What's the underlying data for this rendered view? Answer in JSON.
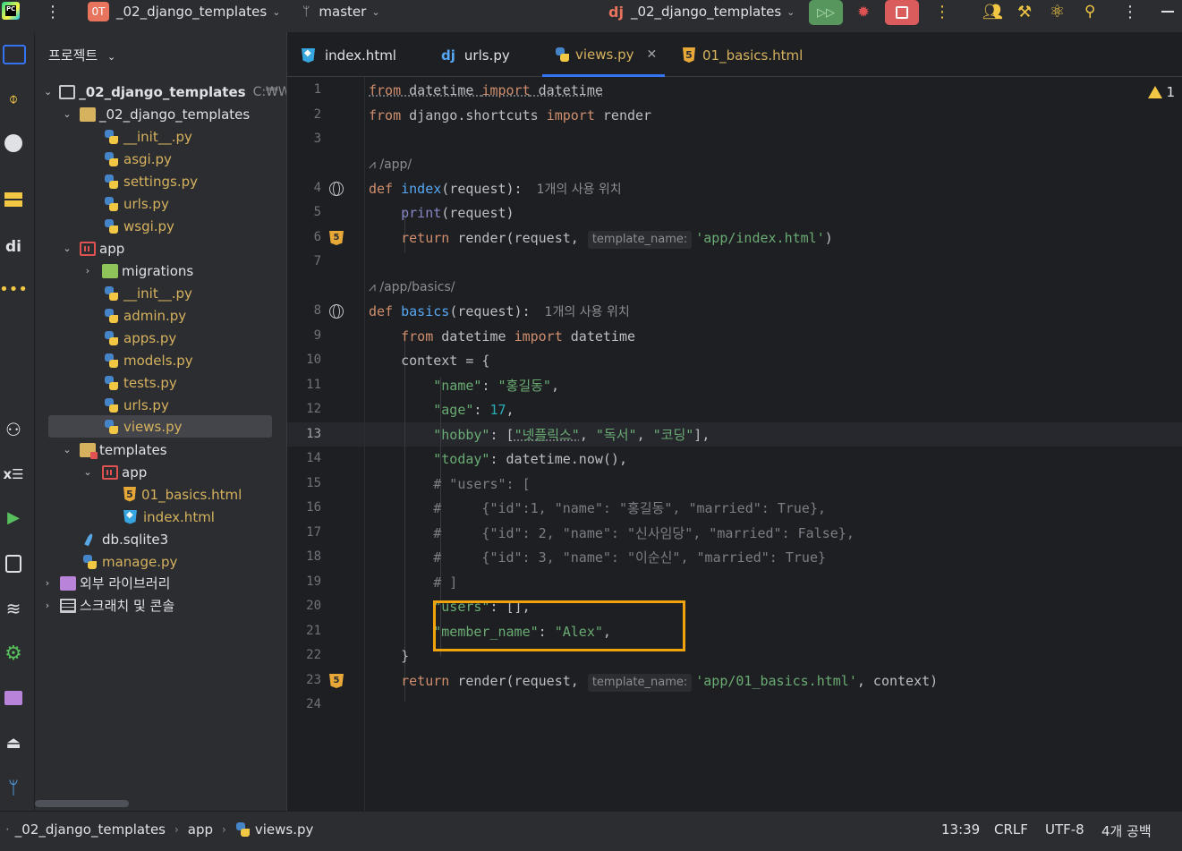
{
  "topbar": {
    "project_badge": "0T",
    "project_name": "_02_django_templates",
    "branch": "master",
    "run_config": "_02_django_templates"
  },
  "project_panel": {
    "title": "프로젝트",
    "root_name": "_02_django_templates",
    "root_path": "C:₩Wo",
    "items": [
      {
        "label": "_02_django_templates"
      },
      {
        "label": "__init__.py"
      },
      {
        "label": "asgi.py"
      },
      {
        "label": "settings.py"
      },
      {
        "label": "urls.py"
      },
      {
        "label": "wsgi.py"
      },
      {
        "label": "app"
      },
      {
        "label": "migrations"
      },
      {
        "label": "__init__.py"
      },
      {
        "label": "admin.py"
      },
      {
        "label": "apps.py"
      },
      {
        "label": "models.py"
      },
      {
        "label": "tests.py"
      },
      {
        "label": "urls.py"
      },
      {
        "label": "views.py"
      },
      {
        "label": "templates"
      },
      {
        "label": "app"
      },
      {
        "label": "01_basics.html"
      },
      {
        "label": "index.html"
      },
      {
        "label": "db.sqlite3"
      },
      {
        "label": "manage.py"
      },
      {
        "label": "외부 라이브러리"
      },
      {
        "label": "스크래치 및 콘솔"
      }
    ]
  },
  "tabs": [
    {
      "label": "index.html"
    },
    {
      "label": "urls.py"
    },
    {
      "label": "views.py"
    },
    {
      "label": "01_basics.html"
    }
  ],
  "editor": {
    "warning_count": "1",
    "line_numbers": [
      "1",
      "2",
      "3",
      "4",
      "5",
      "6",
      "7",
      "8",
      "9",
      "10",
      "11",
      "12",
      "13",
      "14",
      "15",
      "16",
      "17",
      "18",
      "19",
      "20",
      "21",
      "22",
      "23",
      "24"
    ],
    "route1": "/app/",
    "route2": "/app/basics/",
    "usage_hint1": "1개의 사용 위치",
    "usage_hint2": "1개의 사용 위치",
    "inlay_template_name": "template_name:",
    "code": {
      "l1_a": "from",
      "l1_b": " datetime ",
      "l1_c": "import",
      "l1_d": " datetime",
      "l2_a": "from",
      "l2_b": " django.shortcuts ",
      "l2_c": "import",
      "l2_d": " render",
      "l4_def": "def",
      "l4_fn": "index",
      "l4_rest": "(request):",
      "l5_fn": "print",
      "l5_rest": "(request)",
      "l6_kw": "return",
      "l6_a": " render(request,",
      "l6_str": "'app/index.html'",
      "l6_end": ")",
      "l8_def": "def",
      "l8_fn": "basics",
      "l8_rest": "(request):",
      "l9_a": "from",
      "l9_b": " datetime ",
      "l9_c": "import",
      "l9_d": " datetime",
      "l10": "context = {",
      "l11_k": "\"name\"",
      "l11_s": "\"홍길동\"",
      "l12_k": "\"age\"",
      "l12_n": "17",
      "l13_k": "\"hobby\"",
      "l13_s1": "\"넷플릭스\"",
      "l13_s2": "\"독서\"",
      "l13_s3": "\"코딩\"",
      "l14_k": "\"today\"",
      "l14_rest": "datetime.now(),",
      "l15": "# \"users\": [",
      "l16": "#     {\"id\":1, \"name\": \"홍길동\", \"married\": True},",
      "l17": "#     {\"id\": 2, \"name\": \"신사임당\", \"married\": False},",
      "l18": "#     {\"id\": 3, \"name\": \"이순신\", \"married\": True}",
      "l19": "# ]",
      "l20_k": "\"users\"",
      "l20_rest": "[],",
      "l21_k": "\"member_name\"",
      "l21_s": "\"Alex\"",
      "l22": "}",
      "l23_kw": "return",
      "l23_a": " render(request,",
      "l23_str": "'app/01_basics.html'",
      "l23_end": ", context)"
    }
  },
  "statusbar": {
    "crumb1": "_02_django_templates",
    "crumb2": "app",
    "crumb3": "views.py",
    "position": "13:39",
    "line_sep": "CRLF",
    "encoding": "UTF-8",
    "indent": "4개 공백"
  },
  "colors": {
    "accent": "#3574f0",
    "highlight_box": "#f0a30a",
    "keyword": "#cf8e6d",
    "string": "#6aab73",
    "function": "#56a8f5"
  }
}
